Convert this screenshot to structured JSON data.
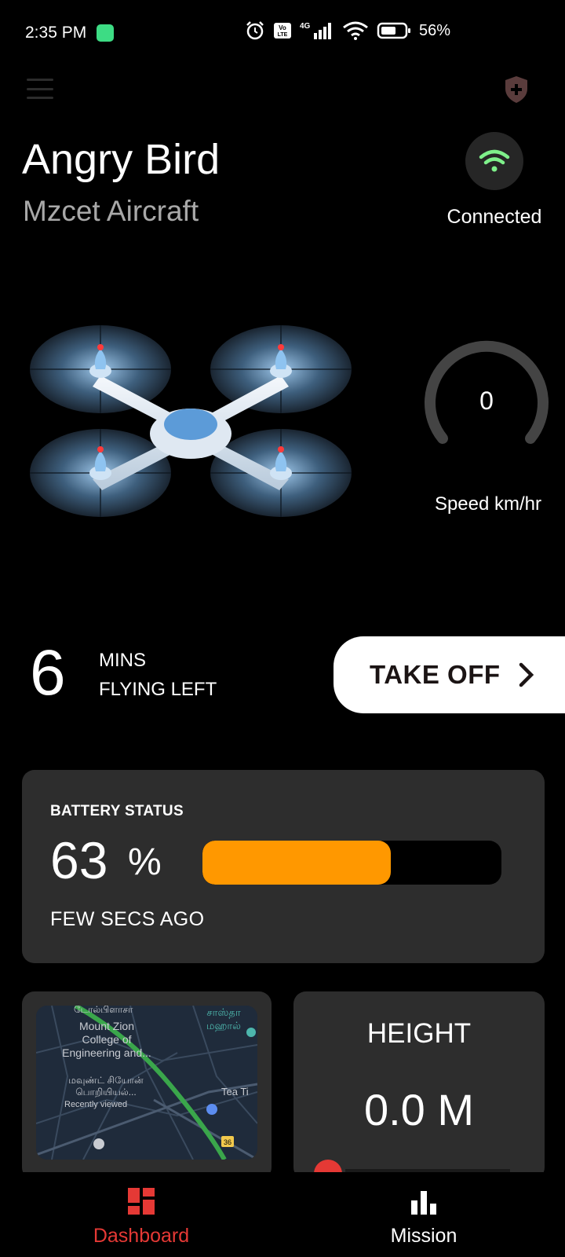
{
  "status_bar": {
    "time": "2:35 PM",
    "network": "4G",
    "volte": "Vo LTE",
    "battery_percent": "56%"
  },
  "header": {
    "title": "Angry Bird",
    "subtitle": "Mzcet Aircraft",
    "connection_label": "Connected"
  },
  "speed": {
    "value": "0",
    "label": "Speed km/hr"
  },
  "flight_time": {
    "minutes": "6",
    "line1": "MINS",
    "line2": "FLYING LEFT"
  },
  "takeoff": {
    "label": "TAKE OFF"
  },
  "battery": {
    "title": "BATTERY STATUS",
    "value": "63",
    "unit": "%",
    "fill_percent": 63,
    "updated": "FEW SECS AGO"
  },
  "map": {
    "label_top": "டோல்பிளாசா",
    "label_college": "Mount Zion College of Engineering and...",
    "label_tamil_1": "மவுண்ட் சியோன் பொறியியல்...",
    "label_recent": "Recently viewed",
    "label_sastha": "சாஸ்தா மஹால்",
    "label_tea": "Tea Ti",
    "road_number": "36"
  },
  "height": {
    "title": "HEIGHT",
    "value": "0.0 M"
  },
  "nav": {
    "dashboard": "Dashboard",
    "mission": "Mission"
  },
  "colors": {
    "accent_red": "#e53935",
    "battery_fill": "#ff9800",
    "wifi_green": "#7ef08a",
    "card_bg": "#2d2d2d"
  }
}
